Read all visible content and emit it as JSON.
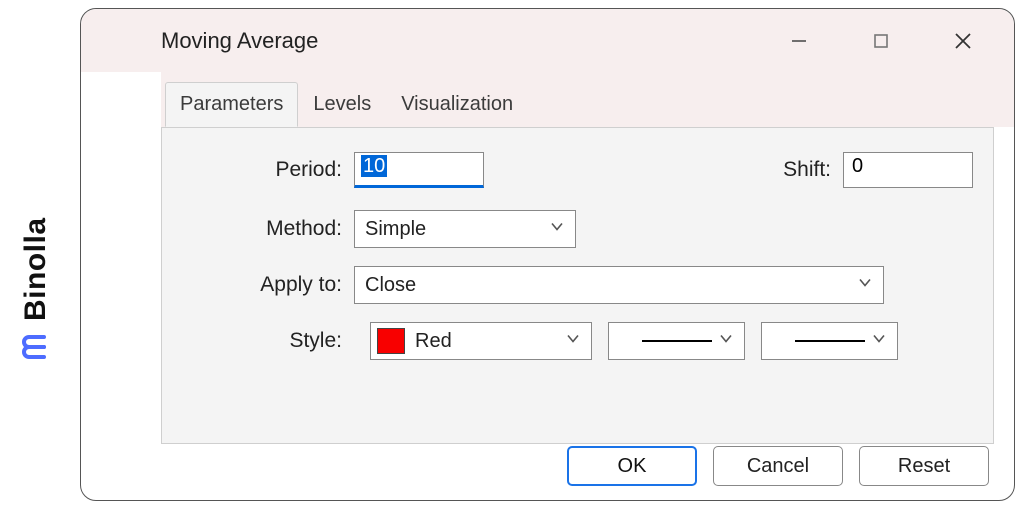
{
  "brand": {
    "name": "Binolla"
  },
  "dialog": {
    "title": "Moving Average",
    "tabs": [
      {
        "label": "Parameters",
        "active": true
      },
      {
        "label": "Levels",
        "active": false
      },
      {
        "label": "Visualization",
        "active": false
      }
    ],
    "labels": {
      "period": "Period:",
      "shift": "Shift:",
      "method": "Method:",
      "apply_to": "Apply to:",
      "style": "Style:"
    },
    "fields": {
      "period_value": "10",
      "shift_value": "0",
      "method_value": "Simple",
      "apply_value": "Close",
      "color_name": "Red",
      "color_hex": "#f80000"
    },
    "buttons": {
      "ok": "OK",
      "cancel": "Cancel",
      "reset": "Reset"
    }
  }
}
